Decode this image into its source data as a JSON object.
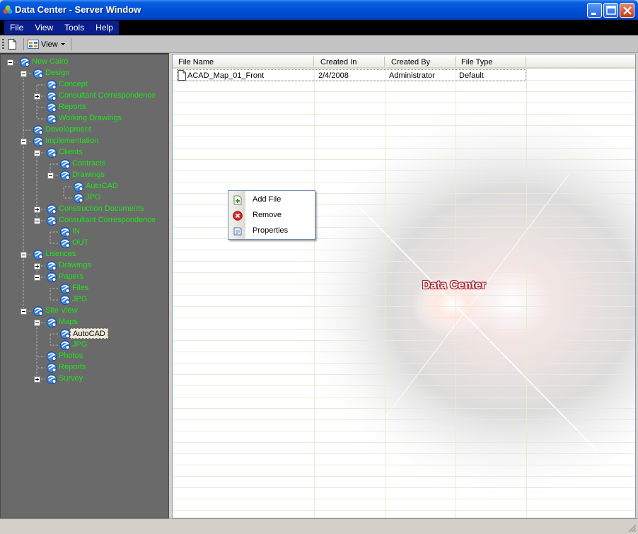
{
  "window": {
    "title": "Data Center - Server Window",
    "icon": "app-icon",
    "controls": [
      "minimize-icon",
      "maximize-icon",
      "close-icon"
    ]
  },
  "menu": {
    "items": [
      {
        "label": "File"
      },
      {
        "label": "View"
      },
      {
        "label": "Tools"
      },
      {
        "label": "Help"
      }
    ]
  },
  "toolbar": {
    "new_icon": "new-document-icon",
    "view_label": "View"
  },
  "tree": {
    "nodes": [
      {
        "label": "New Cairo",
        "depth": 0,
        "expander": "minus"
      },
      {
        "label": "Design",
        "depth": 1,
        "expander": "minus"
      },
      {
        "label": "Concept",
        "depth": 2,
        "expander": "none"
      },
      {
        "label": "Consultant Correspondence",
        "depth": 2,
        "expander": "plus"
      },
      {
        "label": "Reports",
        "depth": 2,
        "expander": "none"
      },
      {
        "label": "Working Drawings",
        "depth": 2,
        "expander": "none"
      },
      {
        "label": "Development",
        "depth": 1,
        "expander": "none"
      },
      {
        "label": "Implementation",
        "depth": 1,
        "expander": "minus"
      },
      {
        "label": "Clients",
        "depth": 2,
        "expander": "minus"
      },
      {
        "label": "Contracts",
        "depth": 3,
        "expander": "none"
      },
      {
        "label": "Drawings",
        "depth": 3,
        "expander": "minus"
      },
      {
        "label": "AutoCAD",
        "depth": 4,
        "expander": "none"
      },
      {
        "label": "JPG",
        "depth": 4,
        "expander": "none"
      },
      {
        "label": "Construction Documents",
        "depth": 2,
        "expander": "plus"
      },
      {
        "label": "Consultant Correspondence",
        "depth": 2,
        "expander": "minus"
      },
      {
        "label": "IN",
        "depth": 3,
        "expander": "none"
      },
      {
        "label": "OUT",
        "depth": 3,
        "expander": "none"
      },
      {
        "label": "Lisences",
        "depth": 1,
        "expander": "minus"
      },
      {
        "label": "Drawings",
        "depth": 2,
        "expander": "plus"
      },
      {
        "label": "Papers",
        "depth": 2,
        "expander": "minus"
      },
      {
        "label": "Files",
        "depth": 3,
        "expander": "none"
      },
      {
        "label": "JPG",
        "depth": 3,
        "expander": "none"
      },
      {
        "label": "Site View",
        "depth": 1,
        "expander": "minus"
      },
      {
        "label": "Maps",
        "depth": 2,
        "expander": "minus"
      },
      {
        "label": "AutoCAD",
        "depth": 3,
        "expander": "none",
        "selected": true
      },
      {
        "label": "JPG",
        "depth": 3,
        "expander": "none"
      },
      {
        "label": "Photos",
        "depth": 2,
        "expander": "none"
      },
      {
        "label": "Reports",
        "depth": 2,
        "expander": "none"
      },
      {
        "label": "Survey",
        "depth": 2,
        "expander": "plus"
      }
    ],
    "label_color": "#1fe41f",
    "background": "#6a6a6a"
  },
  "list": {
    "columns": [
      "File Name",
      "Created In",
      "Created By",
      "File Type"
    ],
    "rows": [
      {
        "file_name": "ACAD_Map_01_Front",
        "created_in": "2/4/2008",
        "created_by": "Administrator",
        "file_type": "Default",
        "icon": "document-icon"
      }
    ],
    "background_logo": "Data Center"
  },
  "context_menu": {
    "items": [
      {
        "label": "Add File",
        "icon": "add-file-icon"
      },
      {
        "label": "Remove",
        "icon": "remove-icon"
      },
      {
        "label": "Properties",
        "icon": "properties-icon"
      }
    ]
  },
  "colors": {
    "titlebar": "#0050d8",
    "menu_highlight": "#0a1e8c",
    "tree_text": "#1fe41f"
  }
}
